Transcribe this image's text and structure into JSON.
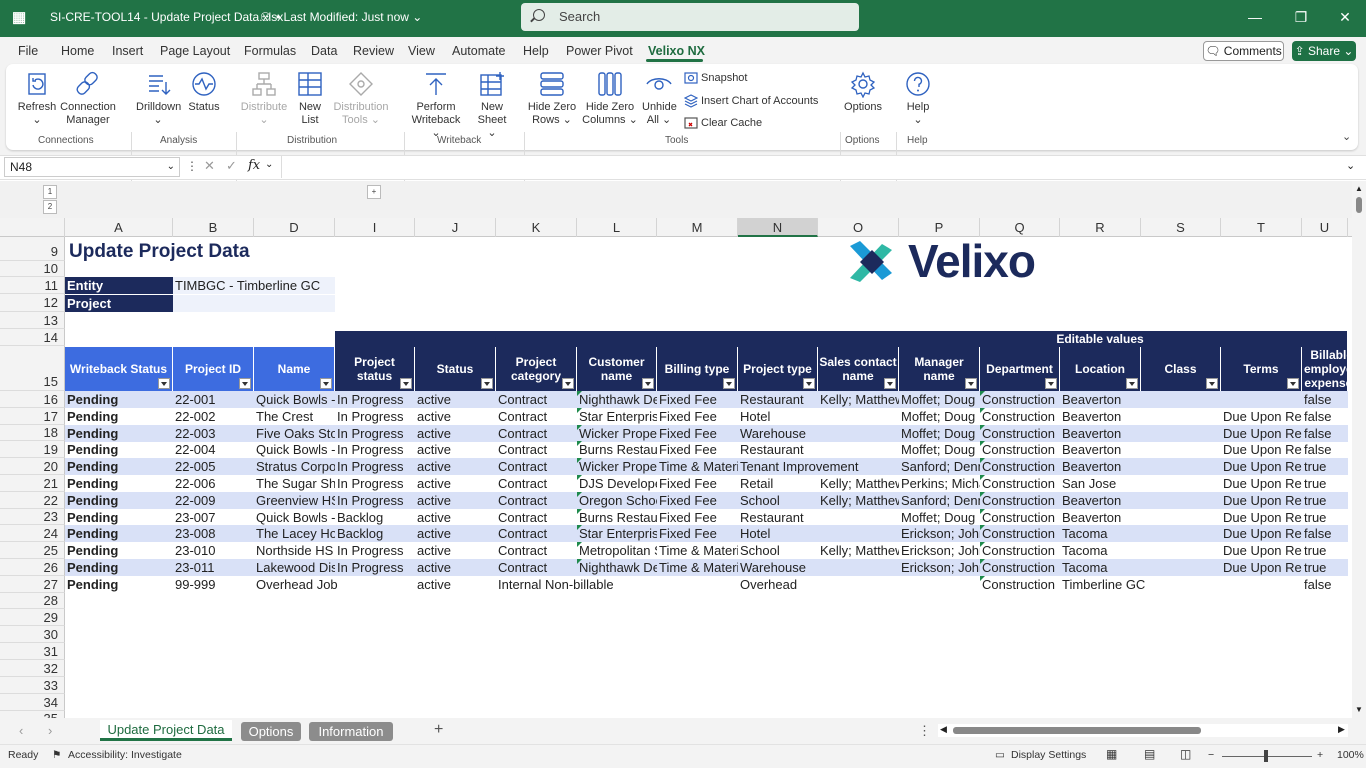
{
  "window": {
    "filename": "SI-CRE-TOOL14 - Update Project Data.xlsx",
    "modified": "Last Modified: Just now",
    "search_placeholder": "Search"
  },
  "menu": [
    "File",
    "Home",
    "Insert",
    "Page Layout",
    "Formulas",
    "Data",
    "Review",
    "View",
    "Automate",
    "Help",
    "Power Pivot",
    "Velixo NX"
  ],
  "topright": {
    "comments": "Comments",
    "share": "Share"
  },
  "ribbon": {
    "refresh": "Refresh",
    "connection1": "Connection",
    "connection2": "Manager",
    "drilldown": "Drilldown",
    "status": "Status",
    "distribute": "Distribute",
    "newlist1": "New",
    "newlist2": "List",
    "disttools1": "Distribution",
    "disttools2": "Tools",
    "perform1": "Perform",
    "perform2": "Writeback",
    "newsheet1": "New",
    "newsheet2": "Sheet",
    "hidezr1": "Hide Zero",
    "hidezr2": "Rows",
    "hidezc1": "Hide Zero",
    "hidezc2": "Columns",
    "unhide1": "Unhide",
    "unhide2": "All",
    "snapshot": "Snapshot",
    "insertchart": "Insert Chart of Accounts",
    "clearcache": "Clear Cache",
    "options": "Options",
    "help": "Help",
    "groups": {
      "connections": "Connections",
      "analysis": "Analysis",
      "distribution": "Distribution",
      "writeback": "Writeback",
      "tools": "Tools",
      "options": "Options",
      "help": "Help"
    }
  },
  "formula": {
    "namebox": "N48",
    "fx": "fx"
  },
  "outline": {
    "levels": [
      "1",
      "2"
    ],
    "plus": "+"
  },
  "columns": [
    "A",
    "B",
    "D",
    "I",
    "J",
    "K",
    "L",
    "M",
    "N",
    "O",
    "P",
    "Q",
    "R",
    "S",
    "T",
    "U"
  ],
  "row_numbers": [
    "9",
    "10",
    "11",
    "12",
    "13",
    "14",
    "15",
    "16",
    "17",
    "18",
    "19",
    "20",
    "21",
    "22",
    "23",
    "24",
    "25",
    "26",
    "27",
    "28",
    "29",
    "30",
    "31",
    "32",
    "33",
    "34",
    "35"
  ],
  "sheet": {
    "title": "Update Project Data",
    "entity_label": "Entity",
    "entity_value": "TIMBGC - Timberline GC",
    "project_label": "Project",
    "editable": "Editable values",
    "logo_text": "Velixo",
    "headers": [
      "Writeback Status",
      "Project ID",
      "Name",
      "Project status",
      "Status",
      "Project category",
      "Customer name",
      "Billing type",
      "Project type",
      "Sales contact name",
      "Manager name",
      "Department",
      "Location",
      "Class",
      "Terms",
      "Billable employee expenses"
    ],
    "rows": [
      [
        "Pending",
        "22-001",
        "Quick Bowls - Lake",
        "In Progress",
        "active",
        "Contract",
        "Nighthawk Developments",
        "Fixed Fee",
        "Restaurant",
        "Kelly; Matthew",
        "Moffet; Doug",
        "Construction",
        "Beaverton",
        "",
        "",
        "false"
      ],
      [
        "Pending",
        "22-002",
        "The Crest",
        "In Progress",
        "active",
        "Contract",
        "Star Enterprises",
        "Fixed Fee",
        "Hotel",
        "",
        "Moffet; Doug",
        "Construction",
        "Beaverton",
        "",
        "Due Upon Receipt",
        "false"
      ],
      [
        "Pending",
        "22-003",
        "Five Oaks Storage",
        "In Progress",
        "active",
        "Contract",
        "Wicker Properties",
        "Fixed Fee",
        "Warehouse",
        "",
        "Moffet; Doug",
        "Construction",
        "Beaverton",
        "",
        "Due Upon Receipt",
        "false"
      ],
      [
        "Pending",
        "22-004",
        "Quick Bowls - Hall",
        "In Progress",
        "active",
        "Contract",
        "Burns Restaurants",
        "Fixed Fee",
        "Restaurant",
        "",
        "Moffet; Doug",
        "Construction",
        "Beaverton",
        "",
        "Due Upon Receipt",
        "false"
      ],
      [
        "Pending",
        "22-005",
        "Stratus Corporate",
        "In Progress",
        "active",
        "Contract",
        "Wicker Properties",
        "Time & Materials",
        "Tenant Improvement",
        "",
        "Sanford; Dennis",
        "Construction",
        "Beaverton",
        "",
        "Due Upon Receipt",
        "true"
      ],
      [
        "Pending",
        "22-006",
        "The Sugar Shop",
        "In Progress",
        "active",
        "Contract",
        "DJS Developers",
        "Fixed Fee",
        "Retail",
        "Kelly; Matthew",
        "Perkins; Michael",
        "Construction",
        "San Jose",
        "",
        "Due Upon Receipt",
        "true"
      ],
      [
        "Pending",
        "22-009",
        "Greenview HS",
        "In Progress",
        "active",
        "Contract",
        "Oregon Schools",
        "Fixed Fee",
        "School",
        "Kelly; Matthew",
        "Sanford; Dennis",
        "Construction",
        "Beaverton",
        "",
        "Due Upon Receipt",
        "true"
      ],
      [
        "Pending",
        "23-007",
        "Quick Bowls - Main",
        "Backlog",
        "active",
        "Contract",
        "Burns Restaurants",
        "Fixed Fee",
        "Restaurant",
        "",
        "Moffet; Doug",
        "Construction",
        "Beaverton",
        "",
        "Due Upon Receipt",
        "true"
      ],
      [
        "Pending",
        "23-008",
        "The Lacey Hotel",
        "Backlog",
        "active",
        "Contract",
        "Star Enterprises",
        "Fixed Fee",
        "Hotel",
        "",
        "Erickson; John",
        "Construction",
        "Tacoma",
        "",
        "Due Upon Receipt",
        "false"
      ],
      [
        "Pending",
        "23-010",
        "Northside HS",
        "In Progress",
        "active",
        "Contract",
        "Metropolitan Schools",
        "Time & Materials",
        "School",
        "Kelly; Matthew",
        "Erickson; John",
        "Construction",
        "Tacoma",
        "",
        "Due Upon Receipt",
        "true"
      ],
      [
        "Pending",
        "23-011",
        "Lakewood Distribution",
        "In Progress",
        "active",
        "Contract",
        "Nighthawk Developments",
        "Time & Materials",
        "Warehouse",
        "",
        "Erickson; John",
        "Construction",
        "Tacoma",
        "",
        "Due Upon Receipt",
        "true"
      ],
      [
        "Pending",
        "99-999",
        "Overhead Job",
        "",
        "active",
        "Internal Non-billable",
        "",
        "",
        "Overhead",
        "",
        "",
        "Construction",
        "Timberline GC",
        "",
        "",
        "false"
      ]
    ]
  },
  "tabs": [
    "Update Project Data",
    "Options",
    "Information"
  ],
  "status": {
    "ready": "Ready",
    "accessibility": "Accessibility: Investigate",
    "display": "Display Settings",
    "zoom": "100%"
  }
}
